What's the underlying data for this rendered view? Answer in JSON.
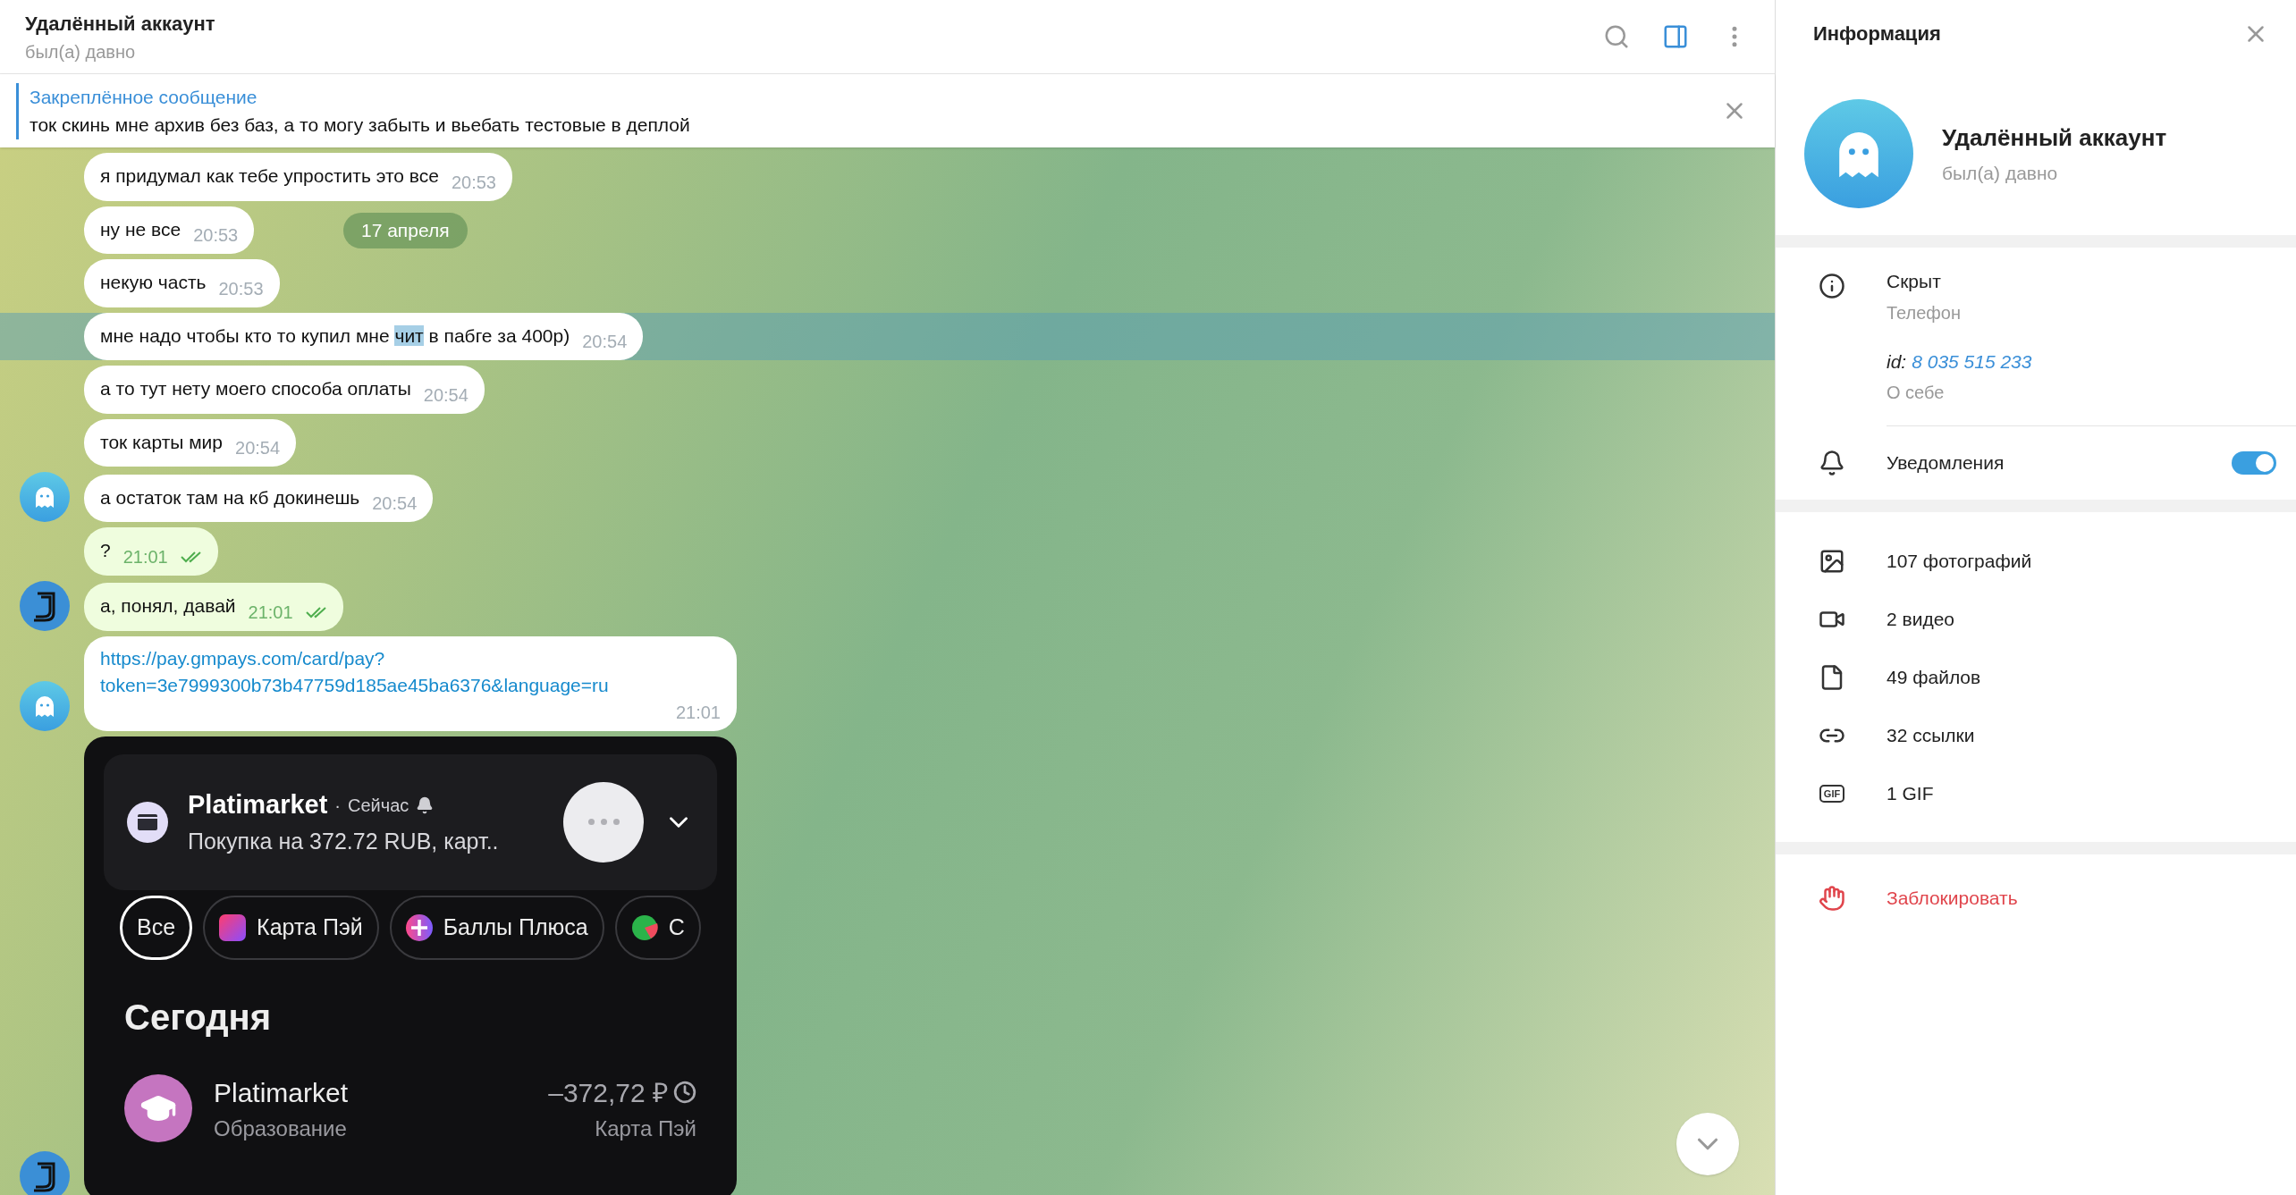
{
  "header": {
    "title": "Удалённый аккаунт",
    "status": "был(а) давно",
    "panel_open": true
  },
  "pinned": {
    "label": "Закреплённое сообщение",
    "text": "ток скинь мне архив без баз, а то могу забыть и вьебать тестовые в деплой"
  },
  "date_badge": "17 апреля",
  "messages": [
    {
      "kind": "text",
      "outgoing": false,
      "text": "я придумал как тебе упростить это все",
      "time": "20:53",
      "show_avatar": false,
      "highlighted": false
    },
    {
      "kind": "text",
      "outgoing": false,
      "text": "ну не все",
      "time": "20:53",
      "show_avatar": false,
      "highlighted": false
    },
    {
      "kind": "text",
      "outgoing": false,
      "text": "некую часть",
      "time": "20:53",
      "show_avatar": false,
      "highlighted": false
    },
    {
      "kind": "text",
      "outgoing": false,
      "parts": [
        {
          "text": "мне надо чтобы кто то купил мне ",
          "selected": false
        },
        {
          "text": "чит",
          "selected": true
        },
        {
          "text": " в пабге за 400р)",
          "selected": false
        }
      ],
      "time": "20:54",
      "show_avatar": false,
      "highlighted": true
    },
    {
      "kind": "text",
      "outgoing": false,
      "text": "а то тут нету моего способа оплаты",
      "time": "20:54",
      "show_avatar": false,
      "highlighted": false
    },
    {
      "kind": "text",
      "outgoing": false,
      "text": "ток карты мир",
      "time": "20:54",
      "show_avatar": false,
      "highlighted": false
    },
    {
      "kind": "text",
      "outgoing": false,
      "text": "а остаток там на кб докинешь",
      "time": "20:54",
      "show_avatar": true,
      "highlighted": false
    },
    {
      "kind": "text",
      "outgoing": true,
      "text": "?",
      "time": "21:01",
      "read": true,
      "show_avatar": false,
      "highlighted": false
    },
    {
      "kind": "text",
      "outgoing": true,
      "text": "а, понял, давай",
      "time": "21:01",
      "read": true,
      "show_avatar": true,
      "highlighted": false
    },
    {
      "kind": "link",
      "outgoing": false,
      "url": "https://pay.gmpays.com/card/pay?token=3e7999300b73b47759d185ae45ba6376&language=ru",
      "time": "21:01",
      "show_avatar": true,
      "highlighted": false
    },
    {
      "kind": "image",
      "outgoing": true,
      "show_avatar": true,
      "highlighted": false,
      "screenshot": {
        "notification": {
          "app": "Platimarket",
          "dot": "·",
          "time": "Сейчас",
          "text": "Покупка на 372.72 RUB, карт.."
        },
        "filters": [
          {
            "label": "Все",
            "selected": true
          },
          {
            "label": "Карта Пэй",
            "selected": false
          },
          {
            "label": "Баллы Плюса",
            "selected": false
          },
          {
            "label": "С",
            "selected": false
          }
        ],
        "section": "Сегодня",
        "transaction": {
          "name": "Platimarket",
          "category": "Образование",
          "amount": "–372,72 ₽",
          "source": "Карта Пэй"
        }
      }
    }
  ],
  "info_panel": {
    "title": "Информация",
    "name": "Удалённый аккаунт",
    "status": "был(а) давно",
    "phone": {
      "value": "Скрыт",
      "label": "Телефон"
    },
    "id": {
      "prefix": "id:",
      "value": "8 035 515 233",
      "label": "О себе"
    },
    "notifications": {
      "label": "Уведомления",
      "on": true
    },
    "media": [
      {
        "kind": "photo",
        "label": "107 фотографий"
      },
      {
        "kind": "video",
        "label": "2 видео"
      },
      {
        "kind": "file",
        "label": "49 файлов"
      },
      {
        "kind": "link",
        "label": "32 ссылки"
      },
      {
        "kind": "gif",
        "label": "1 GIF",
        "badge": "GIF"
      }
    ],
    "block": "Заблокировать"
  }
}
